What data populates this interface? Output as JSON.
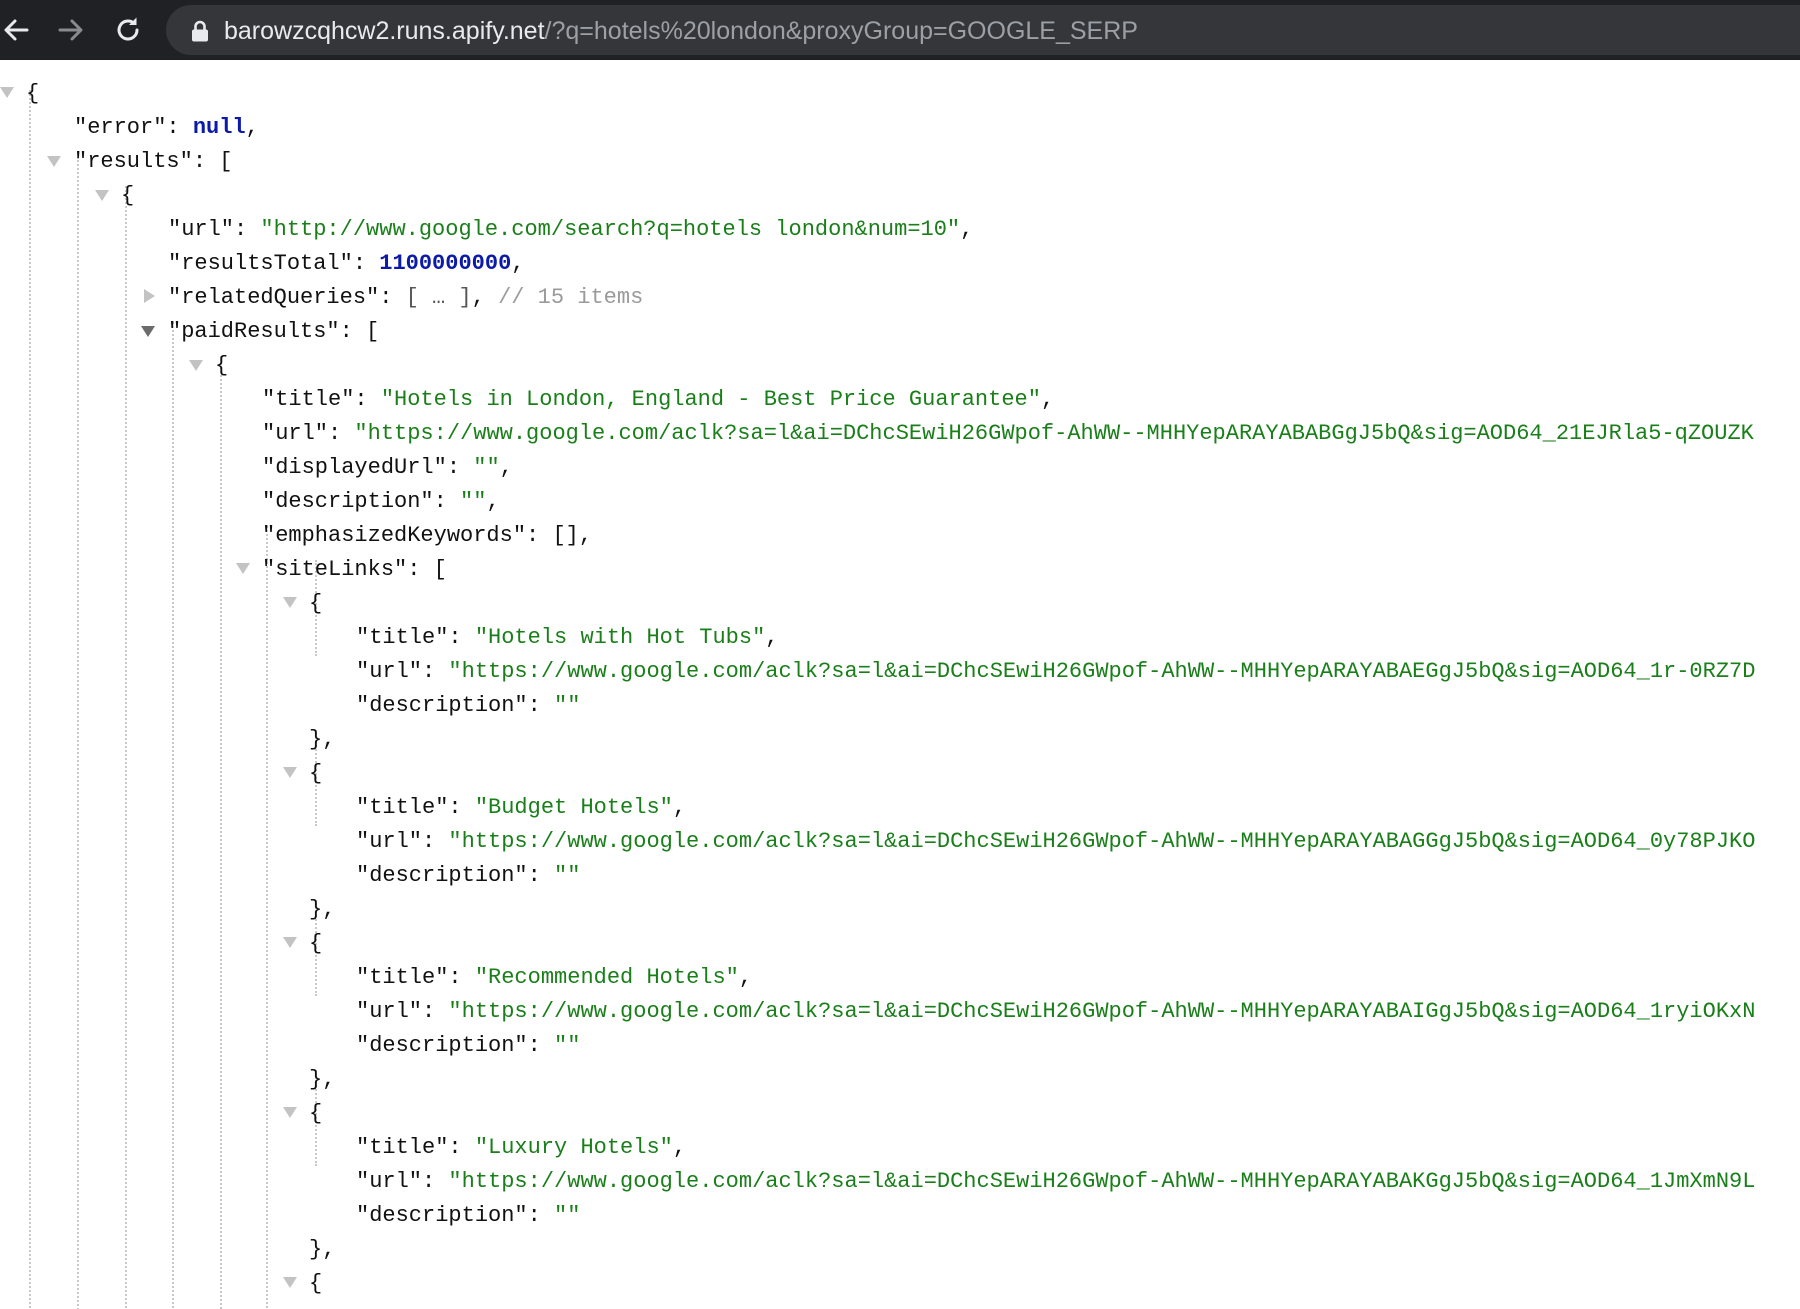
{
  "browser": {
    "url_host": "barowzcqhcw2.runs.apify.net",
    "url_path": "/?q=hotels%20london&proxyGroup=GOOGLE_SERP"
  },
  "json": {
    "l01": "{",
    "l02_key": "\"error\"",
    "l02_colon": ": ",
    "l02_val": "null",
    "l02_tail": ",",
    "l03_key": "\"results\"",
    "l03_tail": ": [",
    "l04": "{",
    "l05_key": "\"url\"",
    "l05_colon": ": ",
    "l05_val": "\"http://www.google.com/search?q=hotels london&num=10\"",
    "l05_tail": ",",
    "l06_key": "\"resultsTotal\"",
    "l06_colon": ": ",
    "l06_val": "1100000000",
    "l06_tail": ",",
    "l07_key": "\"relatedQueries\"",
    "l07_colon": ": ",
    "l07_fold": "[ … ]",
    "l07_tail": ", ",
    "l07_comment": "// 15 items",
    "l08_key": "\"paidResults\"",
    "l08_tail": ": [",
    "l09": "{",
    "l10_key": "\"title\"",
    "l10_colon": ": ",
    "l10_val": "\"Hotels in London, England - Best Price Guarantee\"",
    "l10_tail": ",",
    "l11_key": "\"url\"",
    "l11_colon": ": ",
    "l11_val": "\"https://www.google.com/aclk?sa=l&ai=DChcSEwiH26GWpof-AhWW--MHHYepARAYABABGgJ5bQ&sig=AOD64_21EJRla5-qZOUZK",
    "l12_key": "\"displayedUrl\"",
    "l12_colon": ": ",
    "l12_val": "\"\"",
    "l12_tail": ",",
    "l13_key": "\"description\"",
    "l13_colon": ": ",
    "l13_val": "\"\"",
    "l13_tail": ",",
    "l14_key": "\"emphasizedKeywords\"",
    "l14_tail": ": [],",
    "l15_key": "\"siteLinks\"",
    "l15_tail": ": [",
    "l16": "{",
    "l17_key": "\"title\"",
    "l17_colon": ": ",
    "l17_val": "\"Hotels with Hot Tubs\"",
    "l17_tail": ",",
    "l18_key": "\"url\"",
    "l18_colon": ": ",
    "l18_val": "\"https://www.google.com/aclk?sa=l&ai=DChcSEwiH26GWpof-AhWW--MHHYepARAYABAEGgJ5bQ&sig=AOD64_1r-0RZ7D",
    "l19_key": "\"description\"",
    "l19_colon": ": ",
    "l19_val": "\"\"",
    "l20": "},",
    "l21": "{",
    "l22_key": "\"title\"",
    "l22_colon": ": ",
    "l22_val": "\"Budget Hotels\"",
    "l22_tail": ",",
    "l23_key": "\"url\"",
    "l23_colon": ": ",
    "l23_val": "\"https://www.google.com/aclk?sa=l&ai=DChcSEwiH26GWpof-AhWW--MHHYepARAYABAGGgJ5bQ&sig=AOD64_0y78PJKO",
    "l24_key": "\"description\"",
    "l24_colon": ": ",
    "l24_val": "\"\"",
    "l25": "},",
    "l26": "{",
    "l27_key": "\"title\"",
    "l27_colon": ": ",
    "l27_val": "\"Recommended Hotels\"",
    "l27_tail": ",",
    "l28_key": "\"url\"",
    "l28_colon": ": ",
    "l28_val": "\"https://www.google.com/aclk?sa=l&ai=DChcSEwiH26GWpof-AhWW--MHHYepARAYABAIGgJ5bQ&sig=AOD64_1ryiOKxN",
    "l29_key": "\"description\"",
    "l29_colon": ": ",
    "l29_val": "\"\"",
    "l30": "},",
    "l31": "{",
    "l32_key": "\"title\"",
    "l32_colon": ": ",
    "l32_val": "\"Luxury Hotels\"",
    "l32_tail": ",",
    "l33_key": "\"url\"",
    "l33_colon": ": ",
    "l33_val": "\"https://www.google.com/aclk?sa=l&ai=DChcSEwiH26GWpof-AhWW--MHHYepARAYABAKGgJ5bQ&sig=AOD64_1JmXmN9L",
    "l34_key": "\"description\"",
    "l34_colon": ": ",
    "l34_val": "\"\"",
    "l35": "},",
    "l36": "{"
  },
  "colors": {
    "toolbar_bg": "#202124",
    "omnibox_bg": "#35363a",
    "string": "#1a7f1a",
    "number": "#0b1aa8",
    "comment": "#9a9a9a"
  }
}
